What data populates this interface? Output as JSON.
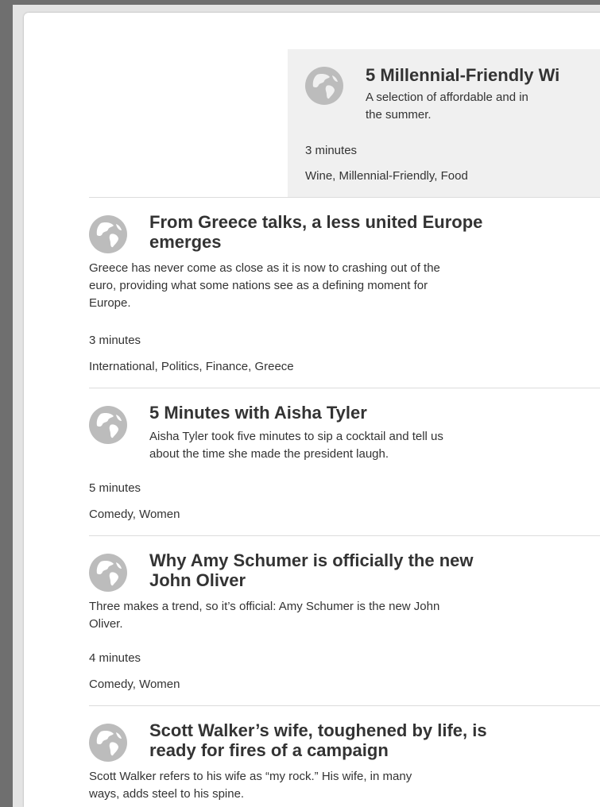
{
  "articles": [
    {
      "title_lines": [
        "5 Millennial-Friendly Wi"
      ],
      "desc_lines": [
        "A selection of affordable and in",
        "the summer."
      ],
      "duration": "3 minutes",
      "tags": "Wine, Millennial-Friendly, Food"
    },
    {
      "title_lines": [
        "From Greece talks, a less united Europe",
        "emerges"
      ],
      "desc_lines": [
        "Greece has never come as close as it is now to crashing out of the",
        "euro, providing what some nations see as a defining moment for",
        "Europe."
      ],
      "duration": "3 minutes",
      "tags": "International, Politics, Finance, Greece"
    },
    {
      "title_lines": [
        "5 Minutes with Aisha Tyler"
      ],
      "desc_lines": [
        "Aisha Tyler took five minutes to sip a cocktail and tell us",
        "about the time she made the president laugh."
      ],
      "duration": "5 minutes",
      "tags": "Comedy, Women"
    },
    {
      "title_lines": [
        "Why Amy Schumer is officially the new",
        "John Oliver"
      ],
      "desc_lines": [
        "Three makes a trend, so it’s official: Amy Schumer is the new John",
        "Oliver."
      ],
      "duration": "4 minutes",
      "tags": "Comedy, Women"
    },
    {
      "title_lines": [
        "Scott Walker’s wife, toughened by life, is",
        "ready for fires of a campaign"
      ],
      "desc_lines": [
        "Scott Walker refers to his wife as “my rock.” His wife, in many",
        "ways, adds steel to his spine."
      ],
      "duration": "",
      "tags": ""
    }
  ],
  "icons": {
    "article_icon": "globe-icon",
    "chevron": "chevron-right-icon"
  }
}
